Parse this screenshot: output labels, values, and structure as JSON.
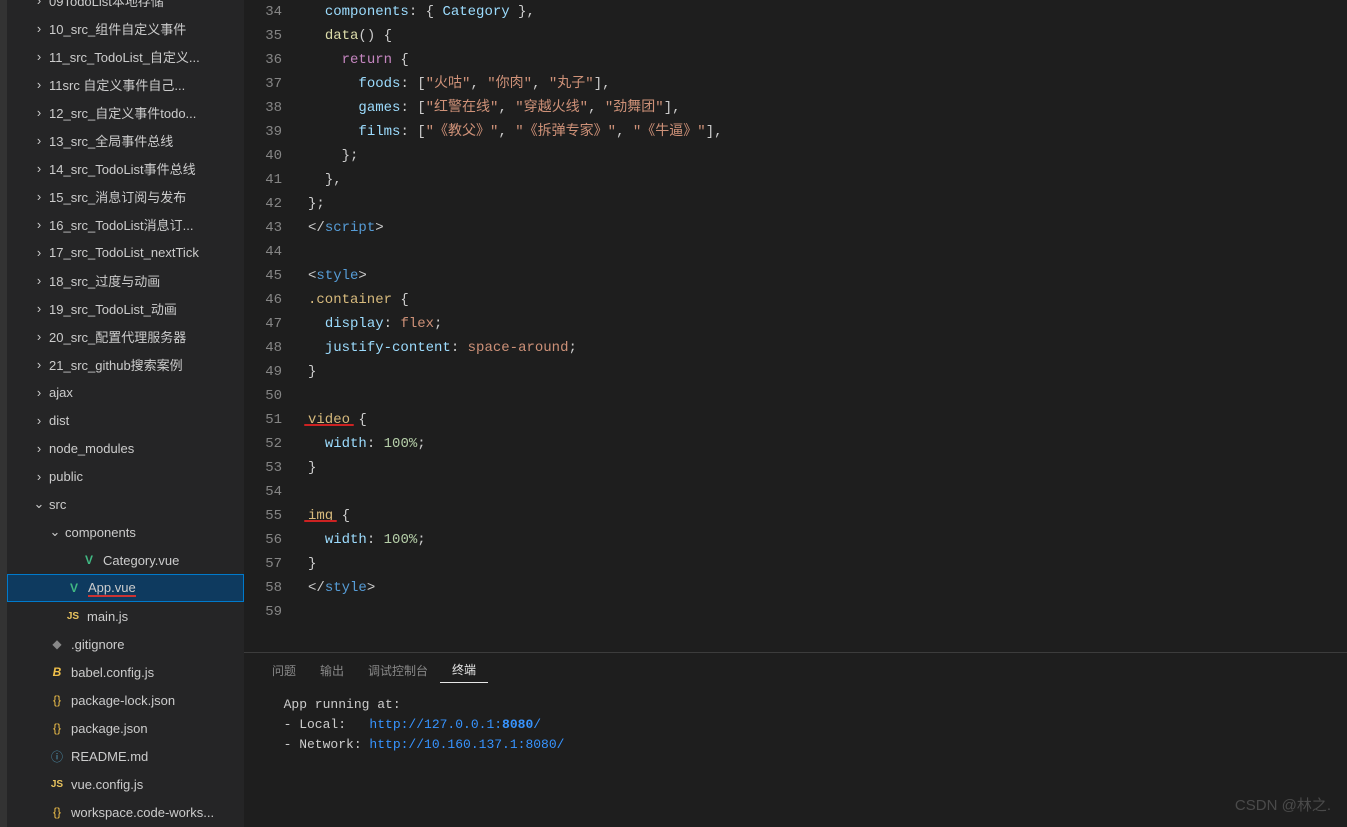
{
  "sidebar": {
    "items": [
      {
        "label": "09TodoList本地存储",
        "type": "folder",
        "indent": 1,
        "cut": true
      },
      {
        "label": "10_src_组件自定义事件",
        "type": "folder",
        "indent": 1
      },
      {
        "label": "11_src_TodoList_自定义...",
        "type": "folder",
        "indent": 1
      },
      {
        "label": "11src 自定义事件自己...",
        "type": "folder",
        "indent": 1
      },
      {
        "label": "12_src_自定义事件todo...",
        "type": "folder",
        "indent": 1
      },
      {
        "label": "13_src_全局事件总线",
        "type": "folder",
        "indent": 1
      },
      {
        "label": "14_src_TodoList事件总线",
        "type": "folder",
        "indent": 1
      },
      {
        "label": "15_src_消息订阅与发布",
        "type": "folder",
        "indent": 1
      },
      {
        "label": "16_src_TodoList消息订...",
        "type": "folder",
        "indent": 1
      },
      {
        "label": "17_src_TodoList_nextTick",
        "type": "folder",
        "indent": 1
      },
      {
        "label": "18_src_过度与动画",
        "type": "folder",
        "indent": 1
      },
      {
        "label": "19_src_TodoList_动画",
        "type": "folder",
        "indent": 1
      },
      {
        "label": "20_src_配置代理服务器",
        "type": "folder",
        "indent": 1
      },
      {
        "label": "21_src_github搜索案例",
        "type": "folder",
        "indent": 1
      },
      {
        "label": "ajax",
        "type": "folder",
        "indent": 1
      },
      {
        "label": "dist",
        "type": "folder",
        "indent": 1
      },
      {
        "label": "node_modules",
        "type": "folder",
        "indent": 1
      },
      {
        "label": "public",
        "type": "folder",
        "indent": 1
      },
      {
        "label": "src",
        "type": "folder-open",
        "indent": 1
      },
      {
        "label": "components",
        "type": "folder-open",
        "indent": 2
      },
      {
        "label": "Category.vue",
        "type": "vue",
        "indent": 3
      },
      {
        "label": "App.vue",
        "type": "vue",
        "indent": 2,
        "selected": true,
        "underline": true
      },
      {
        "label": "main.js",
        "type": "js",
        "indent": 2
      },
      {
        "label": ".gitignore",
        "type": "git",
        "indent": 1
      },
      {
        "label": "babel.config.js",
        "type": "babel",
        "indent": 1
      },
      {
        "label": "package-lock.json",
        "type": "json",
        "indent": 1
      },
      {
        "label": "package.json",
        "type": "json",
        "indent": 1
      },
      {
        "label": "README.md",
        "type": "info",
        "indent": 1
      },
      {
        "label": "vue.config.js",
        "type": "js",
        "indent": 1
      },
      {
        "label": "workspace.code-works...",
        "type": "json",
        "indent": 1
      }
    ]
  },
  "editor": {
    "startLine": 34,
    "lines": [
      {
        "n": 34,
        "html": "  <span class='tok-prop'>components</span><span class='tok-punct'>: { </span><span class='tok-prop'>Category</span><span class='tok-punct'> },</span>"
      },
      {
        "n": 35,
        "html": "  <span class='tok-func'>data</span><span class='tok-punct'>() {</span>"
      },
      {
        "n": 36,
        "html": "    <span class='tok-kw'>return</span><span class='tok-punct'> {</span>"
      },
      {
        "n": 37,
        "html": "      <span class='tok-prop'>foods</span><span class='tok-punct'>: [</span><span class='tok-str'>\"火咕\"</span><span class='tok-punct'>, </span><span class='tok-str'>\"你肉\"</span><span class='tok-punct'>, </span><span class='tok-str'>\"丸子\"</span><span class='tok-punct'>],</span>"
      },
      {
        "n": 38,
        "html": "      <span class='tok-prop'>games</span><span class='tok-punct'>: [</span><span class='tok-str'>\"红警在线\"</span><span class='tok-punct'>, </span><span class='tok-str'>\"穿越火线\"</span><span class='tok-punct'>, </span><span class='tok-str'>\"劲舞团\"</span><span class='tok-punct'>],</span>"
      },
      {
        "n": 39,
        "html": "      <span class='tok-prop'>films</span><span class='tok-punct'>: [</span><span class='tok-str'>\"《教父》\"</span><span class='tok-punct'>, </span><span class='tok-str'>\"《拆弹专家》\"</span><span class='tok-punct'>, </span><span class='tok-str'>\"《牛逼》\"</span><span class='tok-punct'>],</span>"
      },
      {
        "n": 40,
        "html": "    <span class='tok-punct'>};</span>"
      },
      {
        "n": 41,
        "html": "  <span class='tok-punct'>},</span>"
      },
      {
        "n": 42,
        "html": "<span class='tok-punct'>};</span>"
      },
      {
        "n": 43,
        "html": "<span class='tok-punct'>&lt;/</span><span class='tok-tag'>script</span><span class='tok-punct'>&gt;</span>"
      },
      {
        "n": 44,
        "html": ""
      },
      {
        "n": 45,
        "html": "<span class='tok-punct'>&lt;</span><span class='tok-tag'>style</span><span class='tok-punct'>&gt;</span>"
      },
      {
        "n": 46,
        "html": "<span class='tok-css-sel'>.container</span><span class='tok-punct'> {</span>"
      },
      {
        "n": 47,
        "html": "  <span class='tok-css-prop'>display</span><span class='tok-punct'>: </span><span class='tok-css-val'>flex</span><span class='tok-punct'>;</span>"
      },
      {
        "n": 48,
        "html": "  <span class='tok-css-prop'>justify-content</span><span class='tok-punct'>: </span><span class='tok-css-val'>space-around</span><span class='tok-punct'>;</span>"
      },
      {
        "n": 49,
        "html": "<span class='tok-punct'>}</span>"
      },
      {
        "n": 50,
        "html": ""
      },
      {
        "n": 51,
        "html": "<span class='tok-css-sel red-mark'>video</span><span class='tok-punct'> {</span>"
      },
      {
        "n": 52,
        "html": "  <span class='tok-css-prop'>width</span><span class='tok-punct'>: </span><span class='tok-css-num'>100%</span><span class='tok-punct'>;</span>"
      },
      {
        "n": 53,
        "html": "<span class='tok-punct'>}</span>"
      },
      {
        "n": 54,
        "html": ""
      },
      {
        "n": 55,
        "html": "<span class='tok-css-sel red-mark'>img</span><span class='tok-punct'> {</span>"
      },
      {
        "n": 56,
        "html": "  <span class='tok-css-prop'>width</span><span class='tok-punct'>: </span><span class='tok-css-num'>100%</span><span class='tok-punct'>;</span>"
      },
      {
        "n": 57,
        "html": "<span class='tok-punct'>}</span>"
      },
      {
        "n": 58,
        "html": "<span class='tok-punct'>&lt;/</span><span class='tok-tag'>style</span><span class='tok-punct'>&gt;</span>"
      },
      {
        "n": 59,
        "html": ""
      }
    ]
  },
  "panel": {
    "tabs": [
      {
        "label": "问题",
        "active": false
      },
      {
        "label": "输出",
        "active": false
      },
      {
        "label": "调试控制台",
        "active": false
      },
      {
        "label": "终端",
        "active": true
      }
    ],
    "terminal": {
      "line1": "  App running at:",
      "local_label": "  - Local:   ",
      "local_url": "http://127.0.0.1:",
      "local_port": "8080",
      "local_suffix": "/",
      "network_label": "  - Network: ",
      "network_url": "http://10.160.137.1:8080/"
    }
  },
  "watermark": "CSDN @林之."
}
